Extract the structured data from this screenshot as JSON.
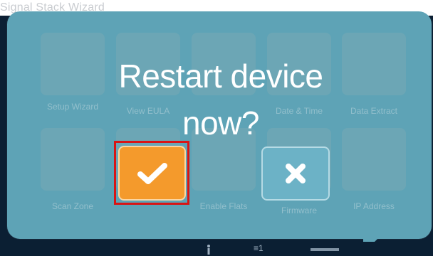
{
  "topbar": {
    "title": "Signal Stack Wizard"
  },
  "dialog": {
    "prompt_line1": "Restart device",
    "prompt_line2": "now?",
    "confirm": {
      "icon": "checkmark-icon"
    },
    "cancel": {
      "icon": "x-icon"
    }
  },
  "background_tiles": [
    {
      "label": "Setup Wizard"
    },
    {
      "label": "View EULA"
    },
    {
      "label": ""
    },
    {
      "label": "Date & Time"
    },
    {
      "label": "Data Extract"
    },
    {
      "label": "Scan Zone"
    },
    {
      "label": ""
    },
    {
      "label": "Enable Flats"
    },
    {
      "label": "Firmware"
    },
    {
      "label": "IP Address"
    }
  ],
  "bottombar": {
    "info_icon": "info-icon",
    "count_label": "≡1"
  },
  "colors": {
    "dialog_bg": "#5ea3b6",
    "confirm_bg": "#f49a2c",
    "cancel_bg": "#6cb2c6",
    "focus_outline": "#d91414"
  }
}
